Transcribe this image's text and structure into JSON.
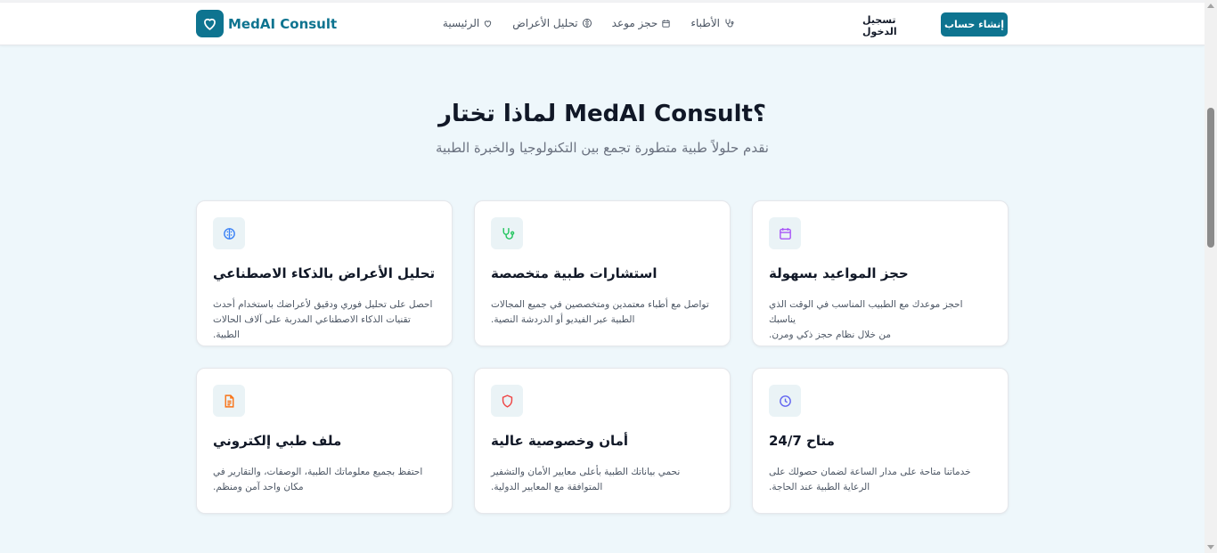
{
  "brand": {
    "name": "MedAI Consult",
    "icon": "heart-icon",
    "color": "#0e7490"
  },
  "nav": [
    {
      "label": "الرئيسية",
      "icon": "heart-icon"
    },
    {
      "label": "تحليل الأعراض",
      "icon": "brain-icon"
    },
    {
      "label": "حجز موعد",
      "icon": "calendar-icon"
    },
    {
      "label": "الأطباء",
      "icon": "stethoscope-icon"
    }
  ],
  "auth": {
    "login_label": "تسجيل الدخول",
    "signup_label": "إنشاء حساب"
  },
  "section": {
    "title": "لماذا تختار MedAI Consult؟",
    "subtitle": "نقدم حلولاً طبية متطورة تجمع بين التكنولوجيا والخبرة الطبية"
  },
  "features": [
    {
      "title": "حجز المواعيد بسهولة",
      "desc_line1": "احجز موعدك مع الطبيب المناسب في الوقت الذي يناسبك",
      "desc_line2": "من خلال نظام حجز ذكي ومرن.",
      "icon": "calendar-icon",
      "color": "#a855f7"
    },
    {
      "title": "استشارات طبية متخصصة",
      "desc_line1": "تواصل مع أطباء معتمدين ومتخصصين في جميع المجالات",
      "desc_line2": "الطبية عبر الفيديو أو الدردشة النصية.",
      "icon": "stethoscope-icon",
      "color": "#22c55e"
    },
    {
      "title": "تحليل الأعراض بالذكاء الاصطناعي",
      "desc_line1": "احصل على تحليل فوري ودقيق لأعراضك باستخدام أحدث",
      "desc_line2": "تقنيات الذكاء الاصطناعي المدربة على آلاف الحالات الطبية.",
      "icon": "brain-icon",
      "color": "#3b82f6"
    },
    {
      "title": "متاح 24/7",
      "desc_line1": "خدماتنا متاحة على مدار الساعة لضمان حصولك على",
      "desc_line2": "الرعاية الطبية عند الحاجة.",
      "icon": "clock-icon",
      "color": "#6366f1"
    },
    {
      "title": "أمان وخصوصية عالية",
      "desc_line1": "نحمي بياناتك الطبية بأعلى معايير الأمان والتشفير",
      "desc_line2": "المتوافقة مع المعايير الدولية.",
      "icon": "shield-icon",
      "color": "#ef4444"
    },
    {
      "title": "ملف طبي إلكتروني",
      "desc_line1": "احتفظ بجميع معلوماتك الطبية، الوصفات، والتقارير في",
      "desc_line2": "مكان واحد آمن ومنظم.",
      "icon": "document-icon",
      "color": "#f97316"
    }
  ]
}
